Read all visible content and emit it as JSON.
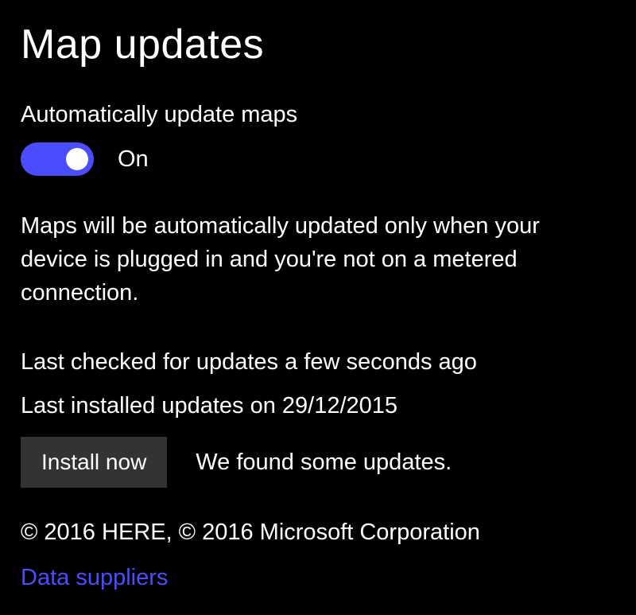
{
  "header": {
    "title": "Map updates"
  },
  "auto_update": {
    "label": "Automatically update maps",
    "state_label": "On",
    "description": "Maps will be automatically updated only when your device is plugged in and you're not on a metered connection."
  },
  "status": {
    "last_checked": "Last checked for updates a few seconds ago",
    "last_installed": "Last installed updates on 29/12/2015"
  },
  "install": {
    "button_label": "Install now",
    "status_text": "We found some updates."
  },
  "footer": {
    "copyright": "© 2016 HERE, © 2016 Microsoft Corporation",
    "link_label": "Data suppliers"
  }
}
